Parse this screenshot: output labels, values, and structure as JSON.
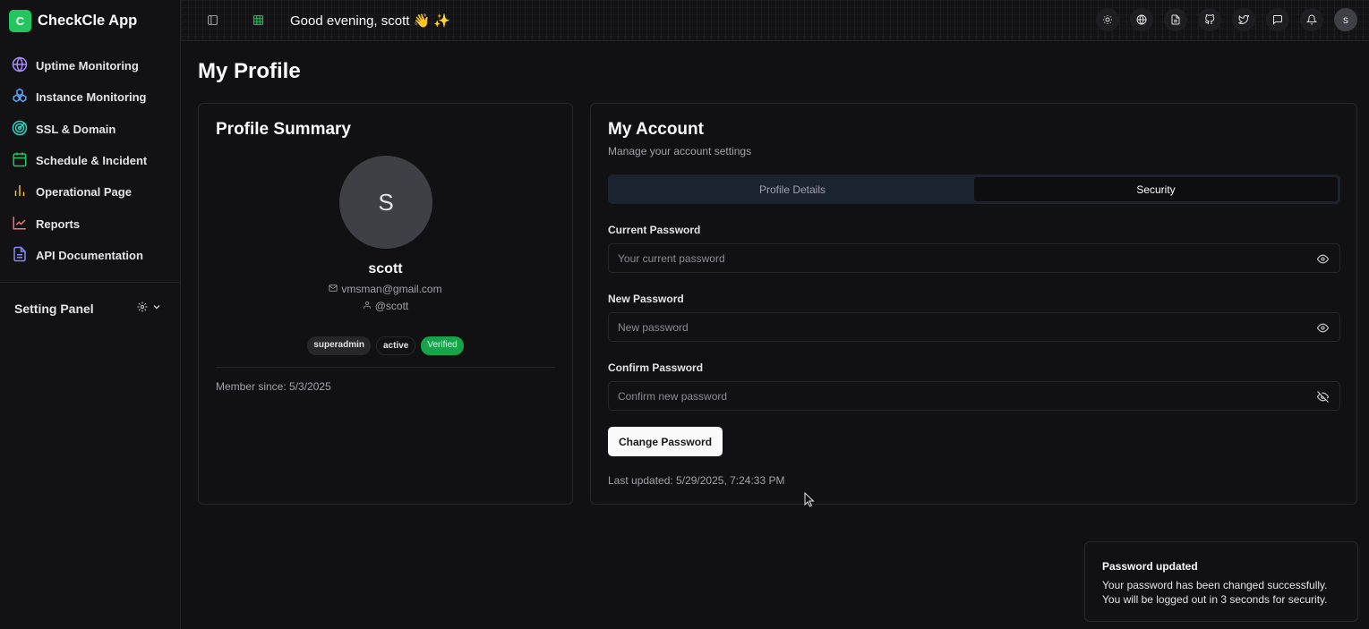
{
  "app": {
    "logo_letter": "C",
    "name": "CheckCle App"
  },
  "sidebar": {
    "items": [
      {
        "label": "Uptime Monitoring",
        "icon": "globe-icon",
        "color": "#a78bfa"
      },
      {
        "label": "Instance Monitoring",
        "icon": "cubes-icon",
        "color": "#60a5fa"
      },
      {
        "label": "SSL & Domain",
        "icon": "radar-icon",
        "color": "#2dd4bf"
      },
      {
        "label": "Schedule & Incident",
        "icon": "calendar-icon",
        "color": "#22c55e"
      },
      {
        "label": "Operational Page",
        "icon": "bar-chart-icon",
        "color": "#fbbf24"
      },
      {
        "label": "Reports",
        "icon": "line-chart-icon",
        "color": "#f87171"
      },
      {
        "label": "API Documentation",
        "icon": "document-icon",
        "color": "#818cf8"
      }
    ],
    "setting_panel": "Setting Panel"
  },
  "header": {
    "greeting": "Good evening, scott 👋 ✨",
    "avatar_letter": "s"
  },
  "page": {
    "title": "My Profile"
  },
  "profile_summary": {
    "title": "Profile Summary",
    "avatar_letter": "S",
    "username": "scott",
    "email": "vmsman@gmail.com",
    "handle": "@scott",
    "badges": [
      "superadmin",
      "active",
      "Verified"
    ],
    "member_since": "Member since: 5/3/2025"
  },
  "account": {
    "title": "My Account",
    "subtitle": "Manage your account settings",
    "tabs": [
      {
        "label": "Profile Details",
        "active": false
      },
      {
        "label": "Security",
        "active": true
      }
    ],
    "fields": [
      {
        "label": "Current Password",
        "placeholder": "Your current password",
        "value": ""
      },
      {
        "label": "New Password",
        "placeholder": "New password",
        "value": ""
      },
      {
        "label": "Confirm Password",
        "placeholder": "Confirm new password",
        "value": ""
      }
    ],
    "submit_label": "Change Password",
    "last_updated": "Last updated: 5/29/2025, 7:24:33 PM"
  },
  "toast": {
    "title": "Password updated",
    "line1": "Your password has been changed successfully.",
    "line2": "You will be logged out in 3 seconds for security."
  },
  "colors": {
    "brand": "#22c55e",
    "verified": "#16a34a",
    "tab_bg": "#1b2330"
  }
}
